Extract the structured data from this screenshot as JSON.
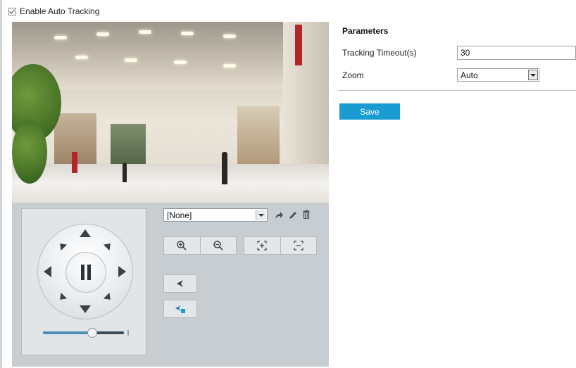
{
  "enable_auto_tracking": {
    "label": "Enable Auto Tracking",
    "checked": true
  },
  "ptz": {
    "preset": {
      "selected": "[None]"
    },
    "speed_level": 0.6
  },
  "parameters": {
    "title": "Parameters",
    "tracking_timeout": {
      "label": "Tracking Timeout(s)",
      "value": "30"
    },
    "zoom": {
      "label": "Zoom",
      "selected": "Auto"
    }
  },
  "save_label": "Save",
  "colors": {
    "accent": "#1a9bd1",
    "panel": "#c7cdd1"
  }
}
